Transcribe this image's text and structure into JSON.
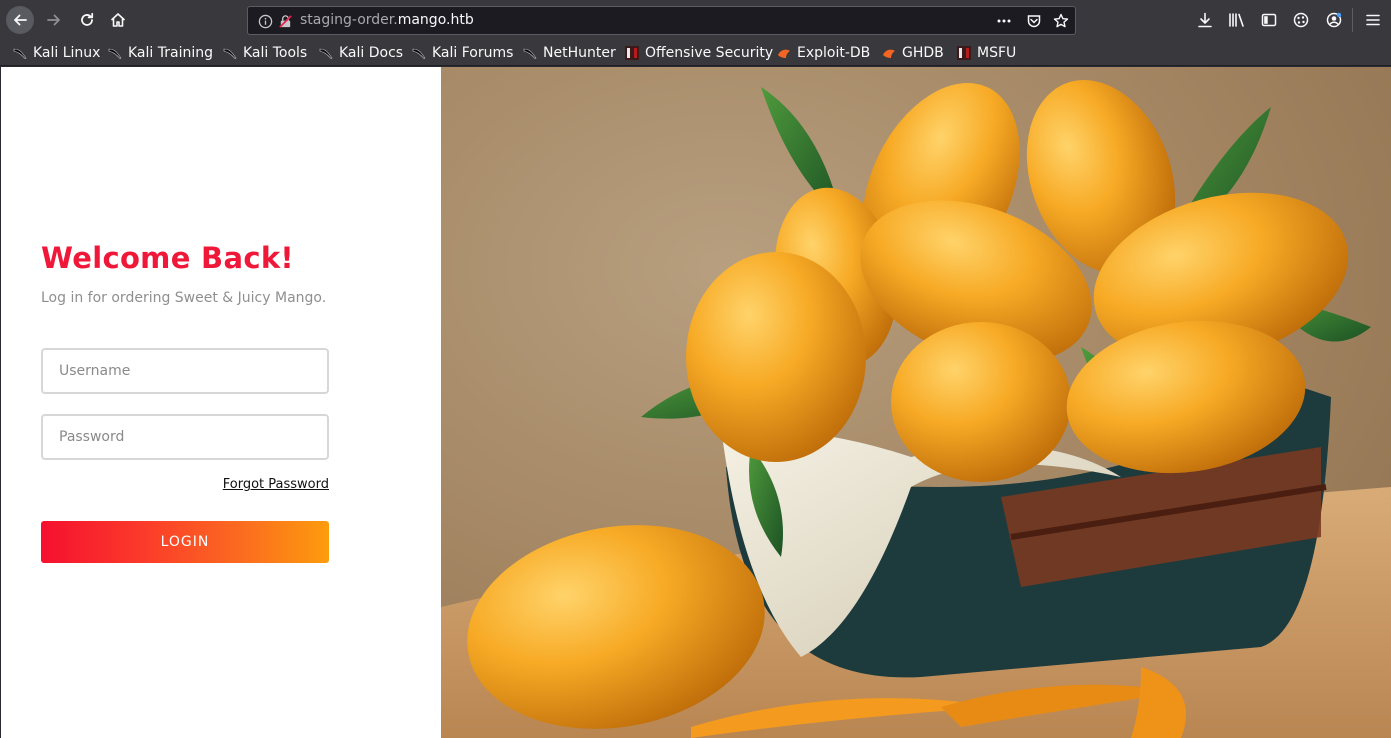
{
  "browser": {
    "url_prefix": "staging-order.",
    "url_domain": "mango.htb",
    "icons": {
      "back": "back-arrow-icon",
      "forward": "forward-arrow-icon",
      "reload": "reload-icon",
      "home": "home-icon",
      "site_info": "info-icon",
      "insecure": "insecure-lock-icon",
      "page_actions": "ellipsis-icon",
      "pocket": "pocket-icon",
      "bookmark": "star-icon",
      "downloads": "download-icon",
      "library": "library-icon",
      "sidebar": "sidebar-icon",
      "extensions": "extensions-icon",
      "account": "account-icon",
      "menu": "hamburger-menu-icon"
    },
    "bookmarks": [
      {
        "label": "Kali Linux",
        "icon": "kali-dragon-icon"
      },
      {
        "label": "Kali Training",
        "icon": "kali-dragon-icon"
      },
      {
        "label": "Kali Tools",
        "icon": "kali-dragon-icon"
      },
      {
        "label": "Kali Docs",
        "icon": "kali-dragon-icon"
      },
      {
        "label": "Kali Forums",
        "icon": "kali-dragon-icon"
      },
      {
        "label": "NetHunter",
        "icon": "kali-dragon-icon"
      },
      {
        "label": "Offensive Security",
        "icon": "offsec-icon"
      },
      {
        "label": "Exploit-DB",
        "icon": "exploitdb-icon"
      },
      {
        "label": "GHDB",
        "icon": "exploitdb-icon"
      },
      {
        "label": "MSFU",
        "icon": "offsec-icon"
      }
    ]
  },
  "login": {
    "title": "Welcome Back!",
    "subtitle": "Log in for ordering Sweet & Juicy Mango.",
    "username_placeholder": "Username",
    "password_placeholder": "Password",
    "forgot_label": "Forgot Password",
    "login_label": "LOGIN"
  },
  "colors": {
    "title": "#ef1839",
    "button_start": "#f5102f",
    "button_end": "#fd9c0d",
    "toolbar": "#38383d",
    "urlbar": "#1c1b22"
  },
  "hero": {
    "icon": "mango-basket-image"
  }
}
